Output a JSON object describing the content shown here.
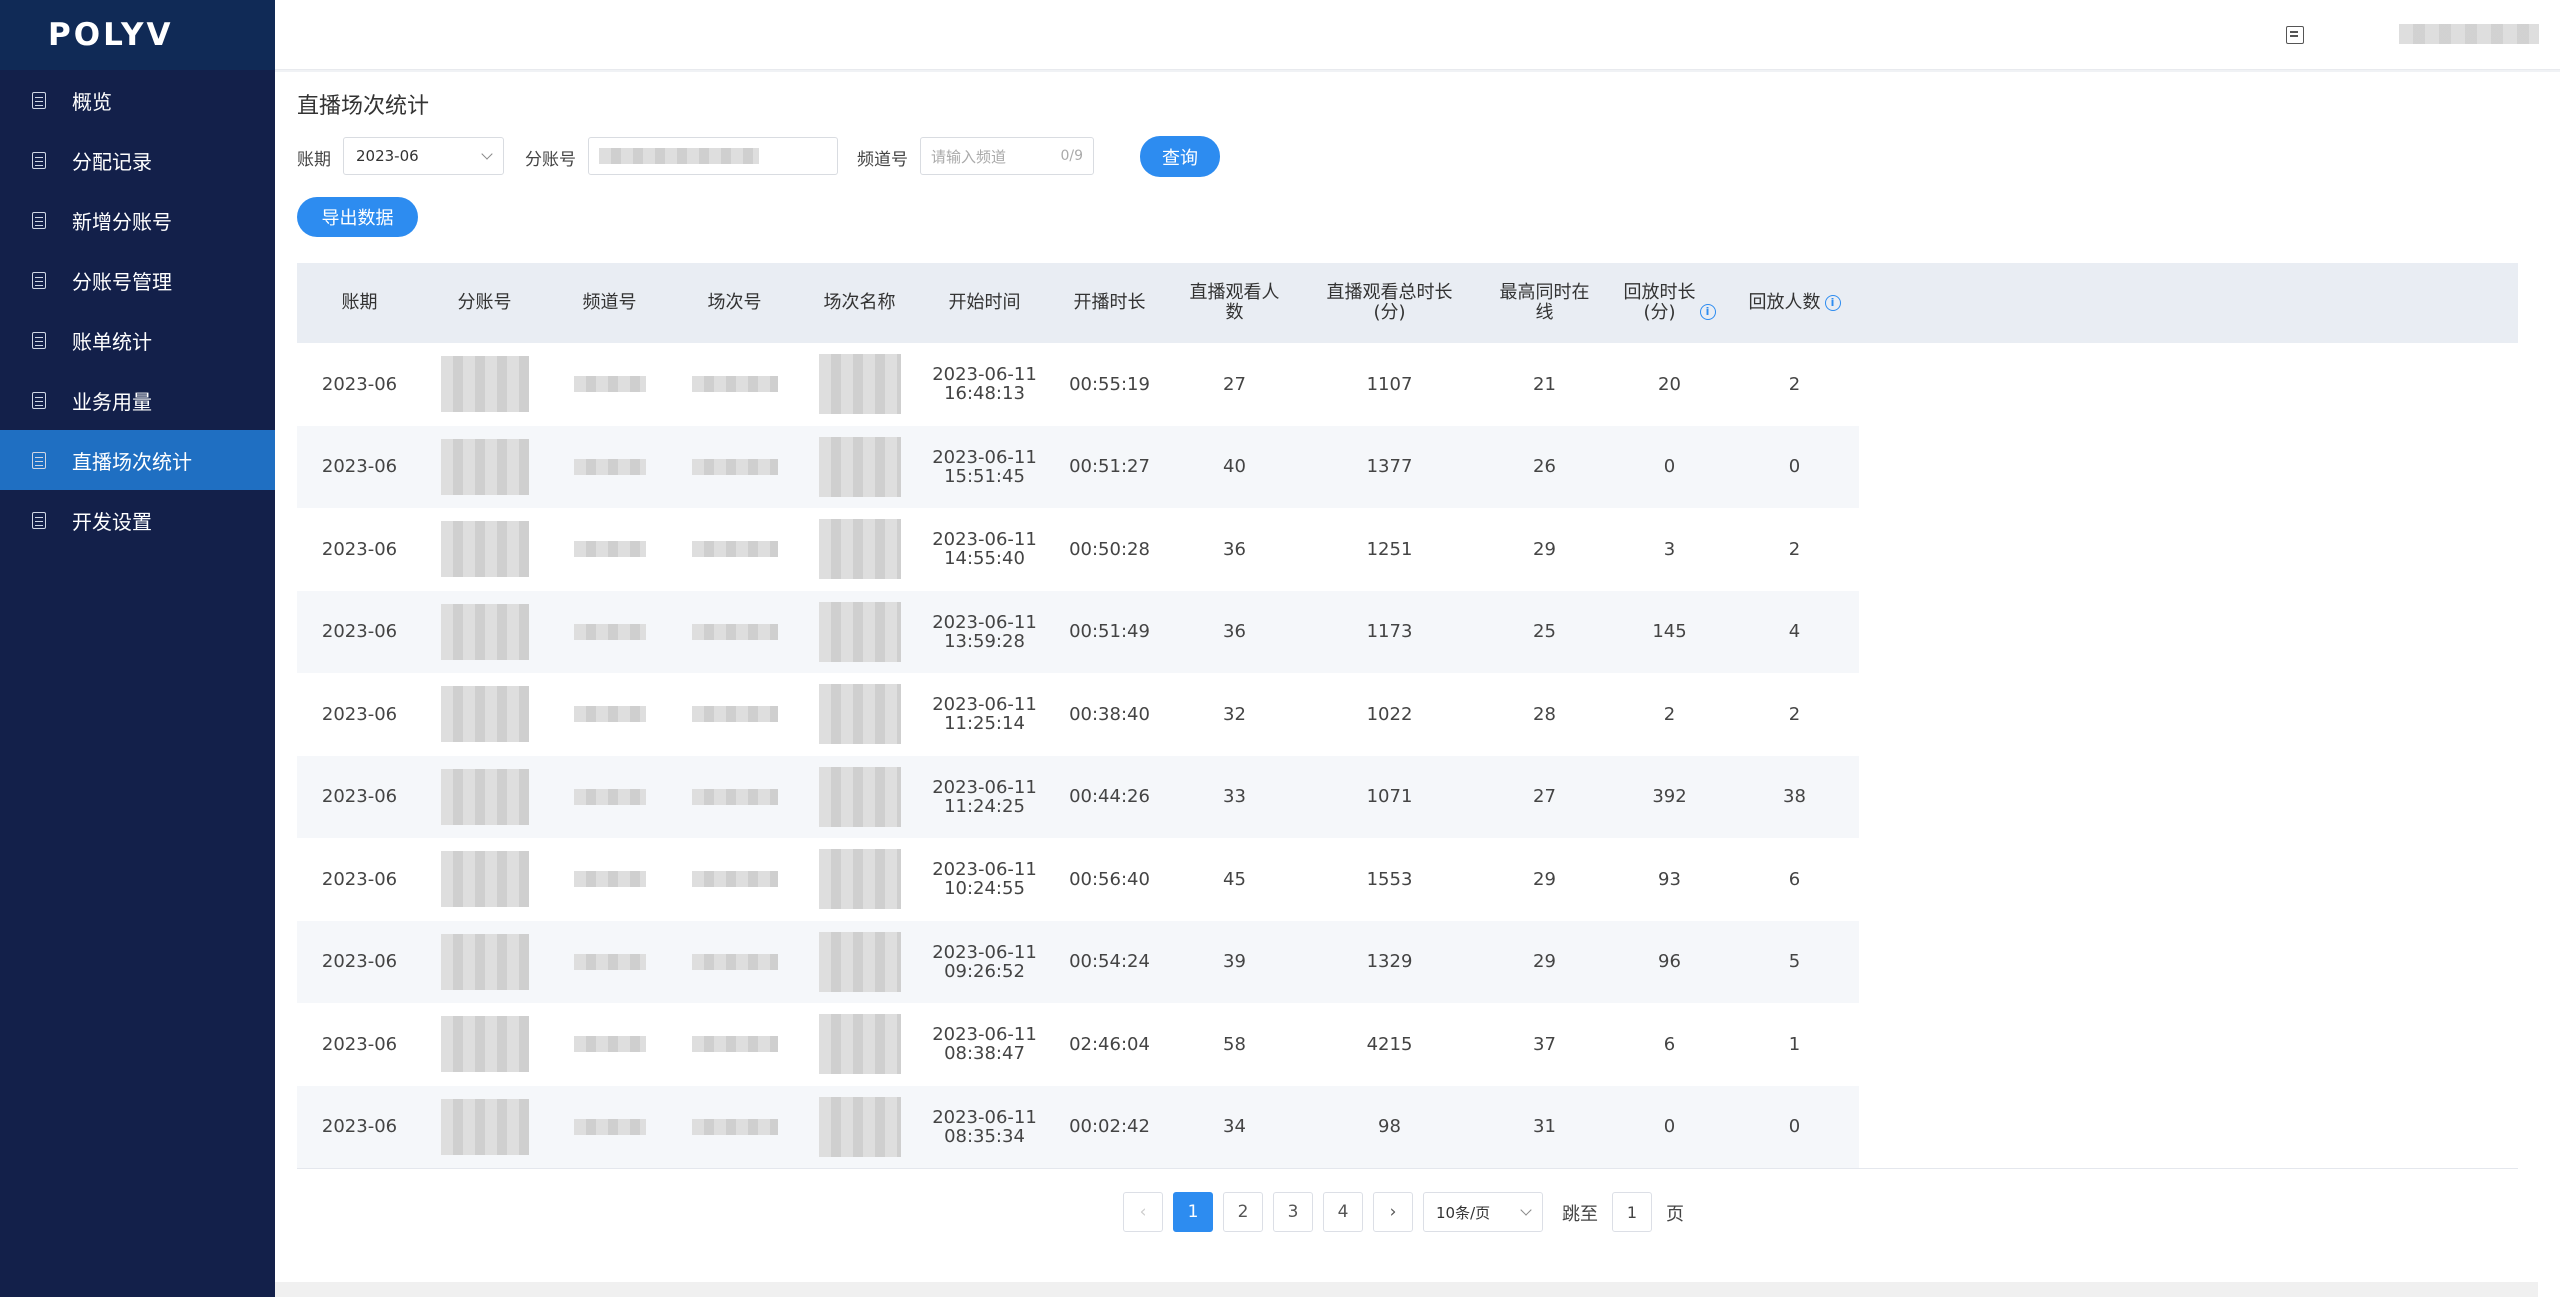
{
  "app": {
    "logo": "POLYV"
  },
  "sidebar": {
    "items": [
      {
        "label": "概览"
      },
      {
        "label": "分配记录"
      },
      {
        "label": "新增分账号"
      },
      {
        "label": "分账号管理"
      },
      {
        "label": "账单统计"
      },
      {
        "label": "业务用量"
      },
      {
        "label": "直播场次统计",
        "active": true
      },
      {
        "label": "开发设置"
      }
    ]
  },
  "header": {
    "icon": "document-icon"
  },
  "page": {
    "title": "直播场次统计"
  },
  "filters": {
    "period_label": "账期",
    "period_value": "2023-06",
    "account_label": "分账号",
    "channel_label": "频道号",
    "channel_placeholder": "请输入频道",
    "channel_count": "0/9",
    "query_button": "查询",
    "export_button": "导出数据"
  },
  "table": {
    "columns": [
      "账期",
      "分账号",
      "频道号",
      "场次号",
      "场次名称",
      "开始时间",
      "开播时长",
      "直播观看人数",
      "直播观看总时长(分)",
      "最高同时在线",
      "回放时长(分)",
      "回放人数"
    ],
    "rows": [
      {
        "period": "2023-06",
        "start_date": "2023-06-11",
        "start_time": "16:48:13",
        "duration": "00:55:19",
        "viewers": "27",
        "watch_total": "1107",
        "peak": "21",
        "replay_min": "20",
        "replay_users": "2"
      },
      {
        "period": "2023-06",
        "start_date": "2023-06-11",
        "start_time": "15:51:45",
        "duration": "00:51:27",
        "viewers": "40",
        "watch_total": "1377",
        "peak": "26",
        "replay_min": "0",
        "replay_users": "0"
      },
      {
        "period": "2023-06",
        "start_date": "2023-06-11",
        "start_time": "14:55:40",
        "duration": "00:50:28",
        "viewers": "36",
        "watch_total": "1251",
        "peak": "29",
        "replay_min": "3",
        "replay_users": "2"
      },
      {
        "period": "2023-06",
        "start_date": "2023-06-11",
        "start_time": "13:59:28",
        "duration": "00:51:49",
        "viewers": "36",
        "watch_total": "1173",
        "peak": "25",
        "replay_min": "145",
        "replay_users": "4"
      },
      {
        "period": "2023-06",
        "start_date": "2023-06-11",
        "start_time": "11:25:14",
        "duration": "00:38:40",
        "viewers": "32",
        "watch_total": "1022",
        "peak": "28",
        "replay_min": "2",
        "replay_users": "2"
      },
      {
        "period": "2023-06",
        "start_date": "2023-06-11",
        "start_time": "11:24:25",
        "duration": "00:44:26",
        "viewers": "33",
        "watch_total": "1071",
        "peak": "27",
        "replay_min": "392",
        "replay_users": "38"
      },
      {
        "period": "2023-06",
        "start_date": "2023-06-11",
        "start_time": "10:24:55",
        "duration": "00:56:40",
        "viewers": "45",
        "watch_total": "1553",
        "peak": "29",
        "replay_min": "93",
        "replay_users": "6"
      },
      {
        "period": "2023-06",
        "start_date": "2023-06-11",
        "start_time": "09:26:52",
        "duration": "00:54:24",
        "viewers": "39",
        "watch_total": "1329",
        "peak": "29",
        "replay_min": "96",
        "replay_users": "5"
      },
      {
        "period": "2023-06",
        "start_date": "2023-06-11",
        "start_time": "08:38:47",
        "duration": "02:46:04",
        "viewers": "58",
        "watch_total": "4215",
        "peak": "37",
        "replay_min": "6",
        "replay_users": "1"
      },
      {
        "period": "2023-06",
        "start_date": "2023-06-11",
        "start_time": "08:35:34",
        "duration": "00:02:42",
        "viewers": "34",
        "watch_total": "98",
        "peak": "31",
        "replay_min": "0",
        "replay_users": "0"
      }
    ]
  },
  "pagination": {
    "prev": "‹",
    "next": "›",
    "pages": [
      "1",
      "2",
      "3",
      "4"
    ],
    "current": "1",
    "page_size": "10条/页",
    "jump_label": "跳至",
    "jump_value": "1",
    "page_unit": "页"
  }
}
